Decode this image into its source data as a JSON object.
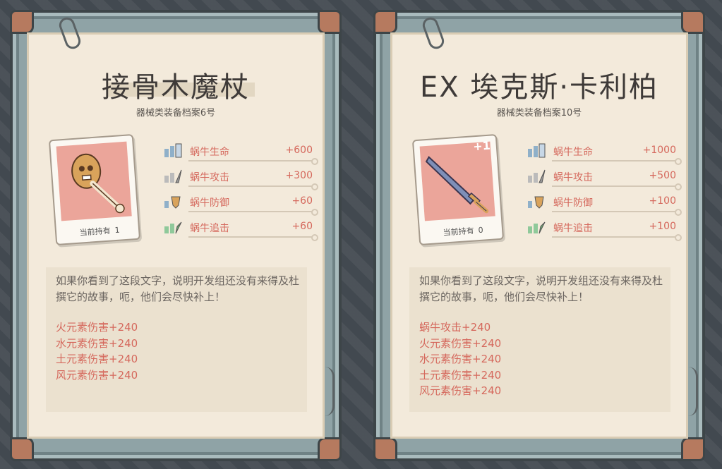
{
  "panels": [
    {
      "title": "接骨木魔杖",
      "subtitle": "器械类装备档案6号",
      "held_label": "当前持有",
      "held_count": "1",
      "bonus": "",
      "stats": [
        {
          "icon": "hp-icon",
          "label": "蜗牛生命",
          "value": "+600"
        },
        {
          "icon": "attack-icon",
          "label": "蜗牛攻击",
          "value": "+300"
        },
        {
          "icon": "defense-icon",
          "label": "蜗牛防御",
          "value": "+60"
        },
        {
          "icon": "chase-icon",
          "label": "蜗牛追击",
          "value": "+60"
        }
      ],
      "description": "如果你看到了这段文字，说明开发组还没有来得及杜撰它的故事，呃，他们会尽快补上！",
      "effects": [
        "火元素伤害+240",
        "水元素伤害+240",
        "土元素伤害+240",
        "风元素伤害+240"
      ]
    },
    {
      "title": "EX 埃克斯·卡利柏",
      "subtitle": "器械类装备档案10号",
      "held_label": "当前持有",
      "held_count": "0",
      "bonus": "+1",
      "stats": [
        {
          "icon": "hp-icon",
          "label": "蜗牛生命",
          "value": "+1000"
        },
        {
          "icon": "attack-icon",
          "label": "蜗牛攻击",
          "value": "+500"
        },
        {
          "icon": "defense-icon",
          "label": "蜗牛防御",
          "value": "+100"
        },
        {
          "icon": "chase-icon",
          "label": "蜗牛追击",
          "value": "+100"
        }
      ],
      "description": "如果你看到了这段文字，说明开发组还没有来得及杜撰它的故事，呃，他们会尽快补上！",
      "effects": [
        "蜗牛攻击+240",
        "火元素伤害+240",
        "水元素伤害+240",
        "土元素伤害+240",
        "风元素伤害+240"
      ]
    }
  ],
  "colors": {
    "accent_red": "#d5685c",
    "paper": "#f3eadb",
    "frame": "#8fa3a6",
    "corner": "#b67a5f"
  }
}
